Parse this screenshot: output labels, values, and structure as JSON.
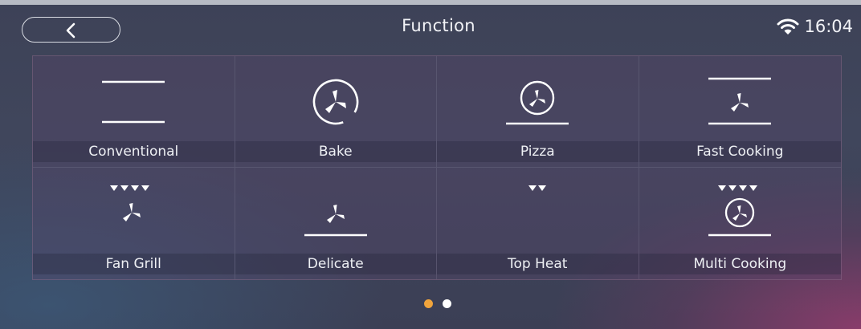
{
  "header": {
    "title": "Function",
    "time": "16:04",
    "back_icon": "chevron-left-icon",
    "wifi_icon": "wifi-icon"
  },
  "functions": [
    {
      "label": "Conventional",
      "icon": "conventional-heat-icon"
    },
    {
      "label": "Bake",
      "icon": "fan-circle-icon"
    },
    {
      "label": "Pizza",
      "icon": "fan-circle-bottom-heat-icon"
    },
    {
      "label": "Fast Cooking",
      "icon": "fan-top-bottom-heat-icon"
    },
    {
      "label": "Fan Grill",
      "icon": "grill-fan-icon"
    },
    {
      "label": "Delicate",
      "icon": "fan-bottom-heat-icon"
    },
    {
      "label": "Top Heat",
      "icon": "top-heat-icon"
    },
    {
      "label": "Multi Cooking",
      "icon": "grill-fan-circle-bottom-icon"
    }
  ],
  "pagination": {
    "pages": 2,
    "current": 1,
    "active_color": "#f0a43c",
    "inactive_color": "#ffffff"
  }
}
